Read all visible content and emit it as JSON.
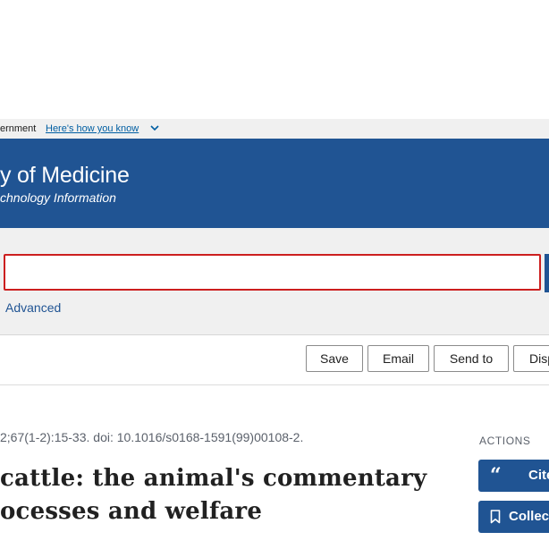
{
  "gov_banner": {
    "text": "ernment",
    "link": "Here's how you know"
  },
  "header": {
    "title": "y of Medicine",
    "subtitle": "chnology Information"
  },
  "search": {
    "value": "",
    "advanced_label": "Advanced"
  },
  "toolbar": {
    "save": "Save",
    "email": "Email",
    "send_to": "Send to",
    "display": "Disp"
  },
  "article": {
    "citation": "2;67(1-2):15-33. doi: 10.1016/s0168-1591(99)00108-2.",
    "title_line1": "cattle: the animal's commentary",
    "title_line2": "ocesses and welfare"
  },
  "actions": {
    "label": "ACTIONS",
    "cite": "Cite",
    "collections": "Collections"
  },
  "colors": {
    "brand_blue": "#205493",
    "link_blue": "#005ea2",
    "search_border_red": "#cc1f1f",
    "banner_gray": "#f0f0f0"
  },
  "icons": {
    "gov_chevron": "chevron-down-icon",
    "cite": "quote-icon",
    "collections": "bookmark-icon"
  }
}
